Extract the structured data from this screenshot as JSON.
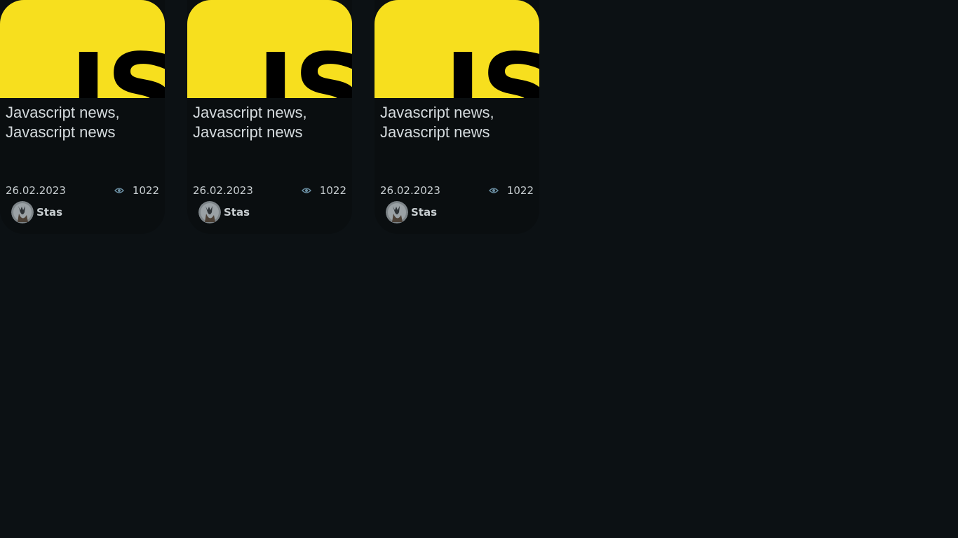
{
  "cards": [
    {
      "logo_text": "JS",
      "title": "Javascript news, Javascript news",
      "date": "26.02.2023",
      "views": "1022",
      "author": "Stas"
    },
    {
      "logo_text": "JS",
      "title": "Javascript news, Javascript news",
      "date": "26.02.2023",
      "views": "1022",
      "author": "Stas"
    },
    {
      "logo_text": "JS",
      "title": "Javascript news, Javascript news",
      "date": "26.02.2023",
      "views": "1022",
      "author": "Stas"
    }
  ],
  "icons": {
    "views": "eye-icon",
    "logo": "javascript-logo"
  },
  "colors": {
    "background": "#0c1114",
    "card": "#0a0e10",
    "js_yellow": "#f7df1e",
    "text": "#d5dbde",
    "eye": "#6b8fa3"
  }
}
